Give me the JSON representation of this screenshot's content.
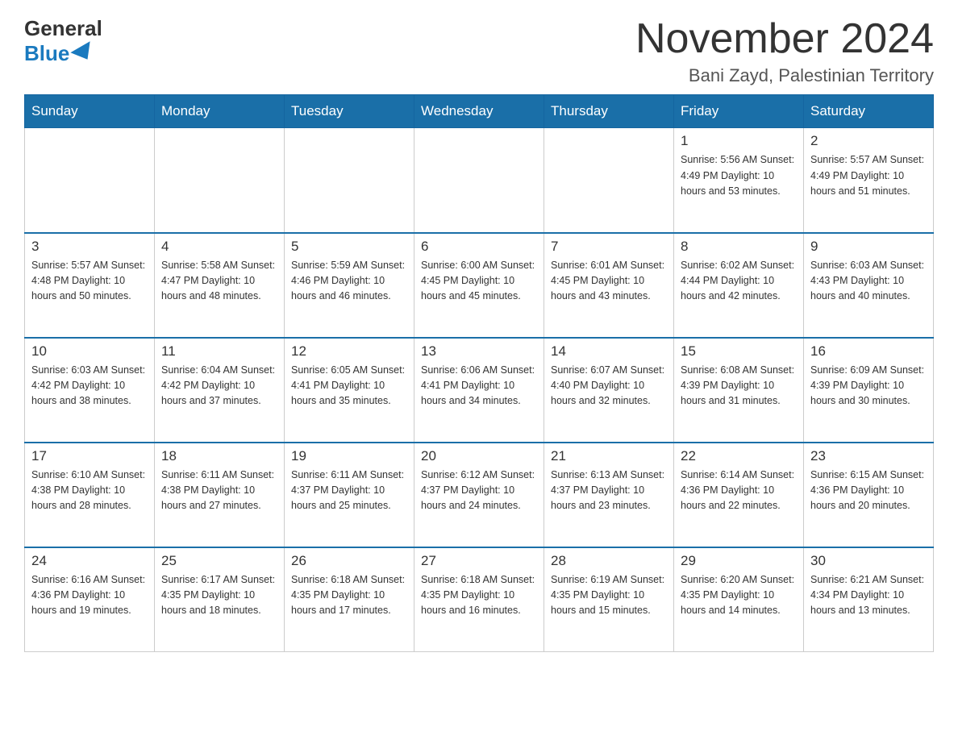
{
  "header": {
    "logo_general": "General",
    "logo_blue": "Blue",
    "month_title": "November 2024",
    "location": "Bani Zayd, Palestinian Territory"
  },
  "weekdays": [
    "Sunday",
    "Monday",
    "Tuesday",
    "Wednesday",
    "Thursday",
    "Friday",
    "Saturday"
  ],
  "weeks": [
    {
      "days": [
        {
          "num": "",
          "info": ""
        },
        {
          "num": "",
          "info": ""
        },
        {
          "num": "",
          "info": ""
        },
        {
          "num": "",
          "info": ""
        },
        {
          "num": "",
          "info": ""
        },
        {
          "num": "1",
          "info": "Sunrise: 5:56 AM\nSunset: 4:49 PM\nDaylight: 10 hours and 53 minutes."
        },
        {
          "num": "2",
          "info": "Sunrise: 5:57 AM\nSunset: 4:49 PM\nDaylight: 10 hours and 51 minutes."
        }
      ]
    },
    {
      "days": [
        {
          "num": "3",
          "info": "Sunrise: 5:57 AM\nSunset: 4:48 PM\nDaylight: 10 hours and 50 minutes."
        },
        {
          "num": "4",
          "info": "Sunrise: 5:58 AM\nSunset: 4:47 PM\nDaylight: 10 hours and 48 minutes."
        },
        {
          "num": "5",
          "info": "Sunrise: 5:59 AM\nSunset: 4:46 PM\nDaylight: 10 hours and 46 minutes."
        },
        {
          "num": "6",
          "info": "Sunrise: 6:00 AM\nSunset: 4:45 PM\nDaylight: 10 hours and 45 minutes."
        },
        {
          "num": "7",
          "info": "Sunrise: 6:01 AM\nSunset: 4:45 PM\nDaylight: 10 hours and 43 minutes."
        },
        {
          "num": "8",
          "info": "Sunrise: 6:02 AM\nSunset: 4:44 PM\nDaylight: 10 hours and 42 minutes."
        },
        {
          "num": "9",
          "info": "Sunrise: 6:03 AM\nSunset: 4:43 PM\nDaylight: 10 hours and 40 minutes."
        }
      ]
    },
    {
      "days": [
        {
          "num": "10",
          "info": "Sunrise: 6:03 AM\nSunset: 4:42 PM\nDaylight: 10 hours and 38 minutes."
        },
        {
          "num": "11",
          "info": "Sunrise: 6:04 AM\nSunset: 4:42 PM\nDaylight: 10 hours and 37 minutes."
        },
        {
          "num": "12",
          "info": "Sunrise: 6:05 AM\nSunset: 4:41 PM\nDaylight: 10 hours and 35 minutes."
        },
        {
          "num": "13",
          "info": "Sunrise: 6:06 AM\nSunset: 4:41 PM\nDaylight: 10 hours and 34 minutes."
        },
        {
          "num": "14",
          "info": "Sunrise: 6:07 AM\nSunset: 4:40 PM\nDaylight: 10 hours and 32 minutes."
        },
        {
          "num": "15",
          "info": "Sunrise: 6:08 AM\nSunset: 4:39 PM\nDaylight: 10 hours and 31 minutes."
        },
        {
          "num": "16",
          "info": "Sunrise: 6:09 AM\nSunset: 4:39 PM\nDaylight: 10 hours and 30 minutes."
        }
      ]
    },
    {
      "days": [
        {
          "num": "17",
          "info": "Sunrise: 6:10 AM\nSunset: 4:38 PM\nDaylight: 10 hours and 28 minutes."
        },
        {
          "num": "18",
          "info": "Sunrise: 6:11 AM\nSunset: 4:38 PM\nDaylight: 10 hours and 27 minutes."
        },
        {
          "num": "19",
          "info": "Sunrise: 6:11 AM\nSunset: 4:37 PM\nDaylight: 10 hours and 25 minutes."
        },
        {
          "num": "20",
          "info": "Sunrise: 6:12 AM\nSunset: 4:37 PM\nDaylight: 10 hours and 24 minutes."
        },
        {
          "num": "21",
          "info": "Sunrise: 6:13 AM\nSunset: 4:37 PM\nDaylight: 10 hours and 23 minutes."
        },
        {
          "num": "22",
          "info": "Sunrise: 6:14 AM\nSunset: 4:36 PM\nDaylight: 10 hours and 22 minutes."
        },
        {
          "num": "23",
          "info": "Sunrise: 6:15 AM\nSunset: 4:36 PM\nDaylight: 10 hours and 20 minutes."
        }
      ]
    },
    {
      "days": [
        {
          "num": "24",
          "info": "Sunrise: 6:16 AM\nSunset: 4:36 PM\nDaylight: 10 hours and 19 minutes."
        },
        {
          "num": "25",
          "info": "Sunrise: 6:17 AM\nSunset: 4:35 PM\nDaylight: 10 hours and 18 minutes."
        },
        {
          "num": "26",
          "info": "Sunrise: 6:18 AM\nSunset: 4:35 PM\nDaylight: 10 hours and 17 minutes."
        },
        {
          "num": "27",
          "info": "Sunrise: 6:18 AM\nSunset: 4:35 PM\nDaylight: 10 hours and 16 minutes."
        },
        {
          "num": "28",
          "info": "Sunrise: 6:19 AM\nSunset: 4:35 PM\nDaylight: 10 hours and 15 minutes."
        },
        {
          "num": "29",
          "info": "Sunrise: 6:20 AM\nSunset: 4:35 PM\nDaylight: 10 hours and 14 minutes."
        },
        {
          "num": "30",
          "info": "Sunrise: 6:21 AM\nSunset: 4:34 PM\nDaylight: 10 hours and 13 minutes."
        }
      ]
    }
  ]
}
